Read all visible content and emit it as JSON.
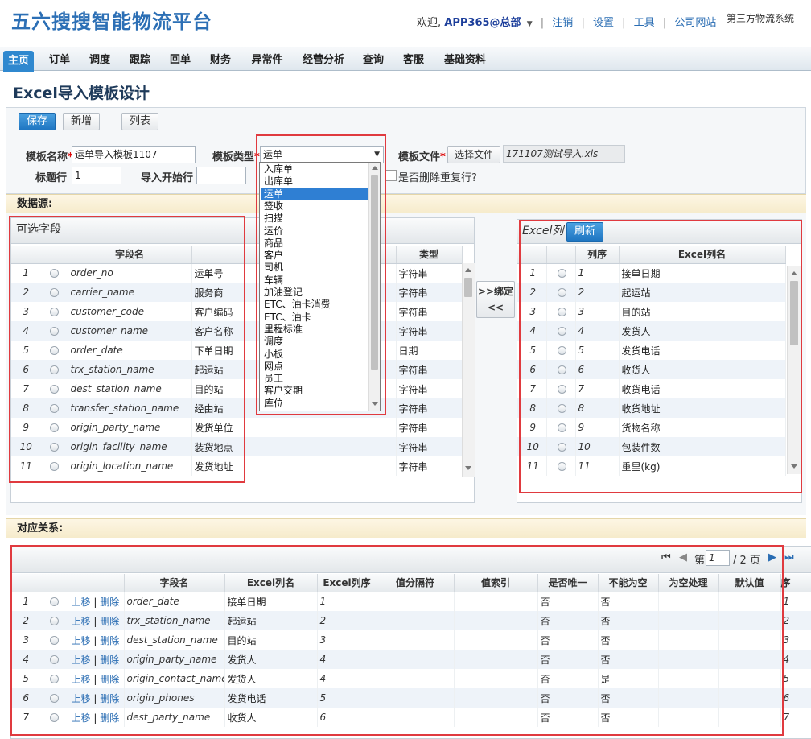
{
  "header": {
    "logo": "五六搜搜智能物流平台",
    "welcome": "欢迎,",
    "user": "APP365@总部",
    "links": [
      "注销",
      "设置",
      "工具",
      "公司网站"
    ],
    "system": "第三方物流系统"
  },
  "menu": [
    "主页",
    "订单",
    "调度",
    "跟踪",
    "回单",
    "财务",
    "异常件",
    "经营分析",
    "查询",
    "客服",
    "基础资料"
  ],
  "page_title": "Excel导入模板设计",
  "toolbar": {
    "save": "保存",
    "add": "新增",
    "list": "列表"
  },
  "form": {
    "template_name_label": "模板名称",
    "template_name_value": "运单导入模板1107",
    "template_type_label": "模板类型",
    "template_type_value": "运单",
    "template_file_label": "模板文件",
    "choose_file": "选择文件",
    "file_name": "171107测试导入.xls",
    "title_row_label": "标题行",
    "title_row_value": "1",
    "start_row_label": "导入开始行",
    "start_row_value": "",
    "dedupe_label": "是否删除重复行?"
  },
  "dropdown_options": [
    "入库单",
    "出库单",
    "运单",
    "签收",
    "扫描",
    "运价",
    "商品",
    "客户",
    "司机",
    "车辆",
    "加油登记",
    "ETC、油卡消费",
    "ETC、油卡",
    "里程标准",
    "调度",
    "小板",
    "网点",
    "员工",
    "客户交期",
    "库位"
  ],
  "datasource_label": "数据源:",
  "fields_panel": {
    "title": "可选字段",
    "headers": [
      "字段名",
      "类型"
    ],
    "rows": [
      [
        "1",
        "order_no",
        "运单号",
        "字符串"
      ],
      [
        "2",
        "carrier_name",
        "服务商",
        "字符串"
      ],
      [
        "3",
        "customer_code",
        "客户编码",
        "字符串"
      ],
      [
        "4",
        "customer_name",
        "客户名称",
        "字符串"
      ],
      [
        "5",
        "order_date",
        "下单日期",
        "日期"
      ],
      [
        "6",
        "trx_station_name",
        "起运站",
        "字符串"
      ],
      [
        "7",
        "dest_station_name",
        "目的站",
        "字符串"
      ],
      [
        "8",
        "transfer_station_name",
        "经由站",
        "字符串"
      ],
      [
        "9",
        "origin_party_name",
        "发货单位",
        "字符串"
      ],
      [
        "10",
        "origin_facility_name",
        "装货地点",
        "字符串"
      ],
      [
        "11",
        "origin_location_name",
        "发货地址",
        "字符串"
      ]
    ]
  },
  "bind_button": ">>绑定<<",
  "excel_panel": {
    "title": "Excel列",
    "refresh": "刷新",
    "headers": [
      "列序",
      "Excel列名"
    ],
    "rows": [
      [
        "1",
        "1",
        "接单日期"
      ],
      [
        "2",
        "2",
        "起运站"
      ],
      [
        "3",
        "3",
        "目的站"
      ],
      [
        "4",
        "4",
        "发货人"
      ],
      [
        "5",
        "5",
        "发货电话"
      ],
      [
        "6",
        "6",
        "收货人"
      ],
      [
        "7",
        "7",
        "收货电话"
      ],
      [
        "8",
        "8",
        "收货地址"
      ],
      [
        "9",
        "9",
        "货物名称"
      ],
      [
        "10",
        "10",
        "包装件数"
      ],
      [
        "11",
        "11",
        "重里(kg)"
      ]
    ]
  },
  "mapping_label": "对应关系:",
  "pager": {
    "prefix": "第",
    "page": "1",
    "suffix": "/ 2 页"
  },
  "mapping_table": {
    "headers": [
      "字段名",
      "Excel列名",
      "Excel列序",
      "值分隔符",
      "值索引",
      "是否唯一",
      "不能为空",
      "为空处理",
      "默认值",
      "序"
    ],
    "move_up": "上移",
    "delete": "删除",
    "rows": [
      [
        "1",
        "order_date",
        "接单日期",
        "1",
        "否",
        "否",
        "1"
      ],
      [
        "2",
        "trx_station_name",
        "起运站",
        "2",
        "否",
        "否",
        "2"
      ],
      [
        "3",
        "dest_station_name",
        "目的站",
        "3",
        "否",
        "否",
        "3"
      ],
      [
        "4",
        "origin_party_name",
        "发货人",
        "4",
        "否",
        "否",
        "4"
      ],
      [
        "5",
        "origin_contact_name",
        "发货人",
        "4",
        "否",
        "是",
        "5"
      ],
      [
        "6",
        "origin_phones",
        "发货电话",
        "5",
        "否",
        "否",
        "6"
      ],
      [
        "7",
        "dest_party_name",
        "收货人",
        "6",
        "否",
        "否",
        "7"
      ]
    ]
  },
  "colors": {
    "accent": "#2f88cf",
    "highlight_box": "#e03a3f",
    "section_bg": "#f6ebcb"
  }
}
